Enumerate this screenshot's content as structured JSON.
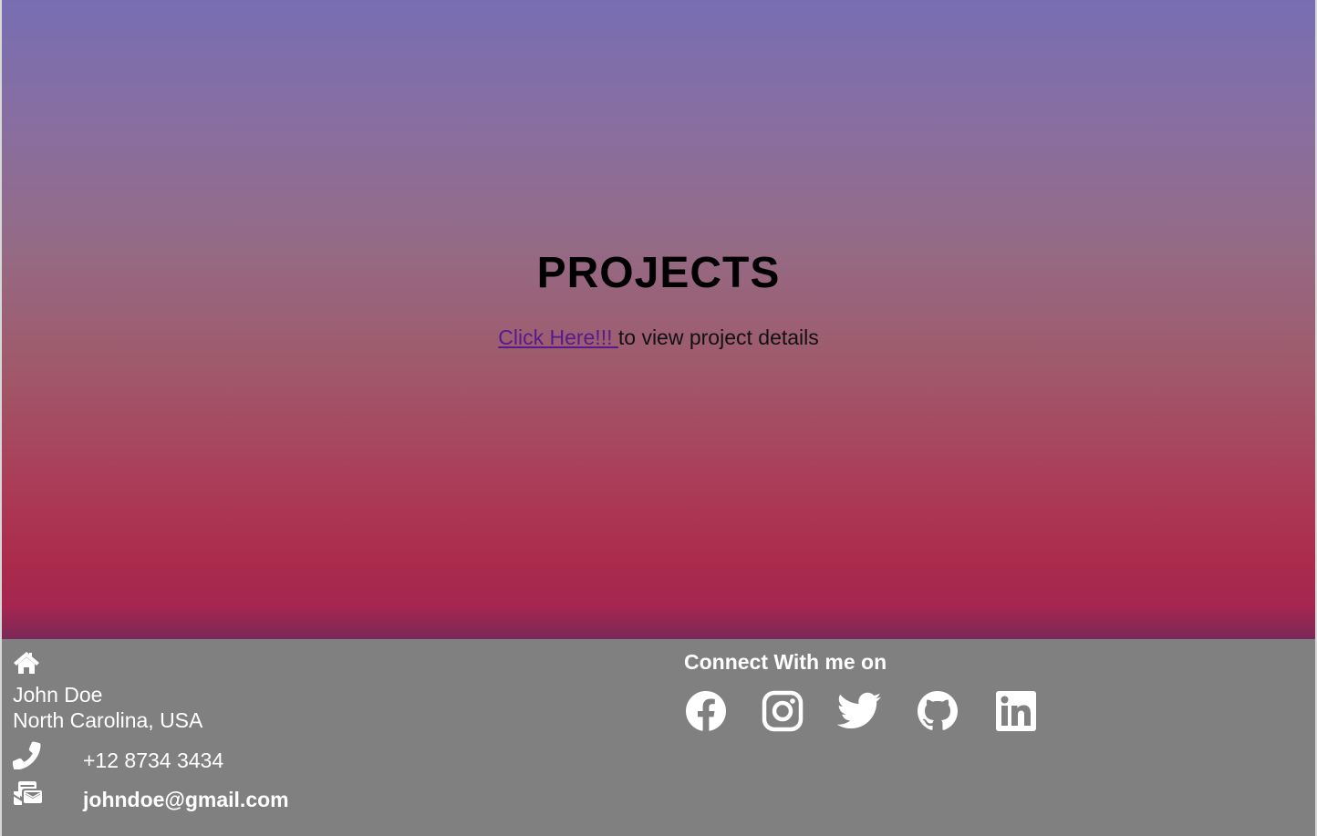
{
  "hero": {
    "title": "PROJECTS",
    "link_label": "Click Here!!! ",
    "link_suffix": "to view project details"
  },
  "footer": {
    "icons": {
      "home": "home-icon",
      "phone": "phone-icon",
      "mail": "mail-icon"
    },
    "name": "John Doe",
    "address": "North Carolina, USA",
    "phone": "+12 8734 3434",
    "email": "johndoe@gmail.com",
    "connect_heading": "Connect With me on",
    "social": [
      "facebook-icon",
      "instagram-icon",
      "twitter-icon",
      "github-icon",
      "linkedin-icon"
    ]
  },
  "colors": {
    "gradient_top": "#776eb2",
    "gradient_bottom": "#ab2b4c",
    "footer_bg": "#808080",
    "link": "#551a8b"
  }
}
